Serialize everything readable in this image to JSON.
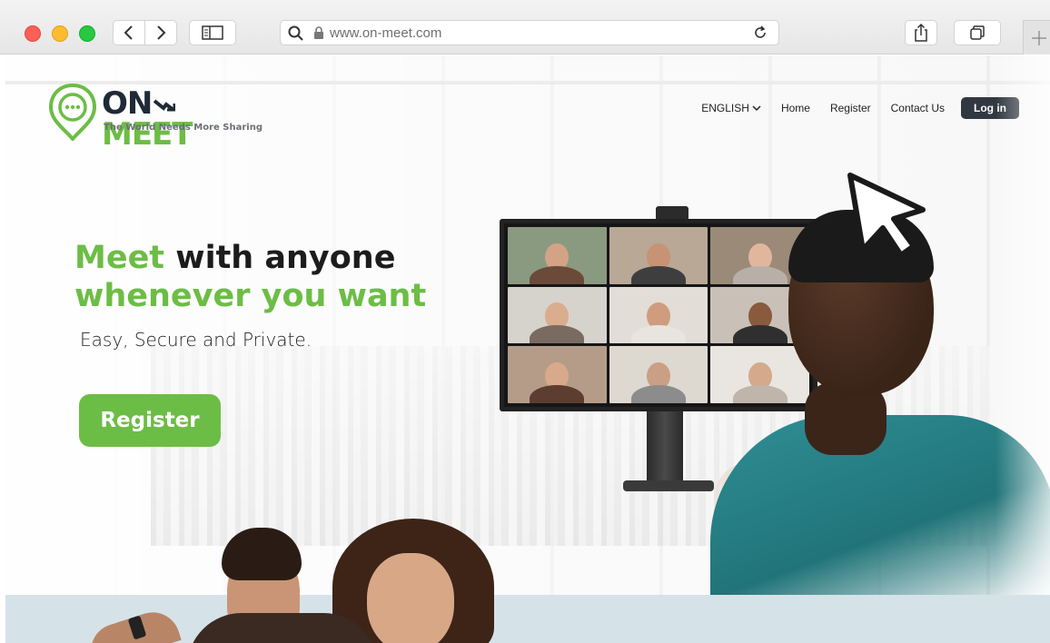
{
  "browser": {
    "url": "www.on-meet.com",
    "icons": {
      "back": "chevron-left-icon",
      "forward": "chevron-right-icon",
      "sidebar": "sidebar-icon",
      "search": "search-icon",
      "lock": "lock-icon",
      "reload": "reload-icon",
      "share": "share-icon",
      "tabs": "tabs-icon",
      "new_tab": "plus-icon"
    },
    "traffic_colors": [
      "#fe5f57",
      "#febc2e",
      "#28c840"
    ]
  },
  "logo": {
    "word_on": "ON",
    "word_meet": "MEET",
    "tagline": "The World Needs More Sharing"
  },
  "nav": {
    "language": "ENGLISH",
    "home": "Home",
    "register": "Register",
    "contact": "Contact Us",
    "login": "Log in"
  },
  "hero": {
    "title_green_1": "Meet",
    "title_dark": "with anyone",
    "title_green_2": "whenever you want",
    "subtitle": "Easy, Secure and Private.",
    "cta": "Register"
  },
  "colors": {
    "brand_green": "#6cbd45",
    "brand_dark": "#1f2a36",
    "login_bg": "#323841",
    "bottom_band": "#d5e3e8"
  }
}
